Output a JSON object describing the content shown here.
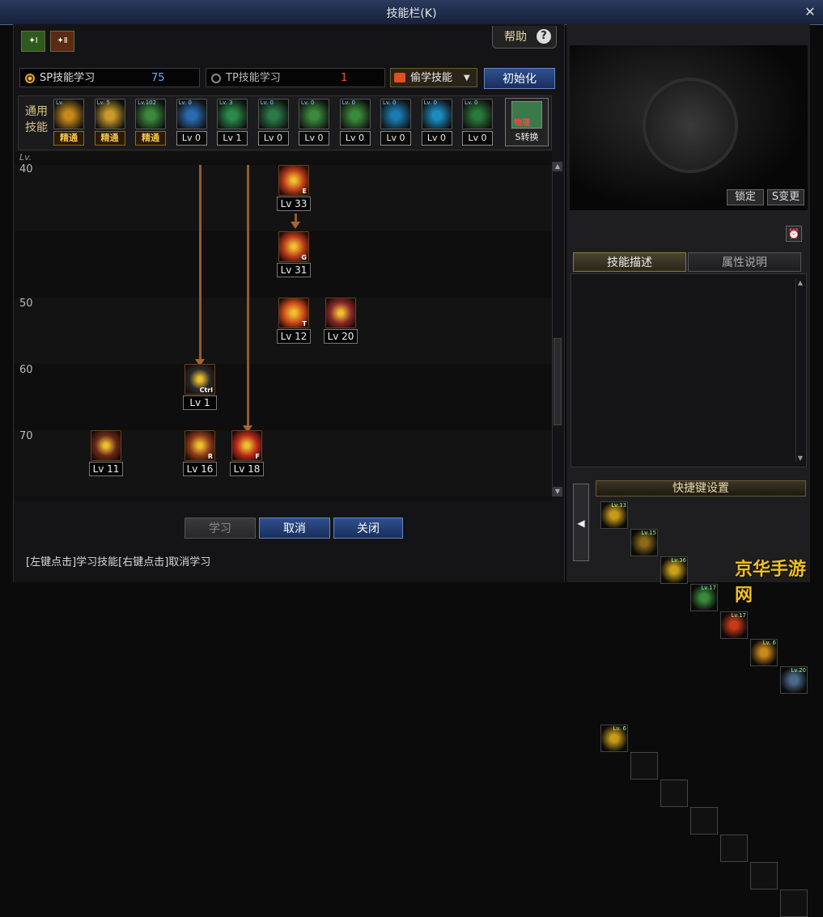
{
  "window": {
    "title": "技能栏(K)",
    "close_glyph": "✕"
  },
  "tabs": [
    {
      "label": "✦Ⅰ"
    },
    {
      "label": "✦Ⅱ"
    }
  ],
  "help": {
    "label": "帮助",
    "icon_glyph": "?"
  },
  "sp": {
    "label": "SP技能学习",
    "value": "75"
  },
  "tp": {
    "label": "TP技能学习",
    "value": "1"
  },
  "steal": {
    "label": "偷学技能"
  },
  "reset_button": "初始化",
  "general": {
    "label": "通用技能",
    "skills": [
      {
        "caption": "精通",
        "lv": "Lv.",
        "color": "#c8881a"
      },
      {
        "caption": "精通",
        "lv": "Lv. 5",
        "color": "#c89a2a"
      },
      {
        "caption": "精通",
        "lv": "Lv.102",
        "color": "#3a8a3a"
      },
      {
        "caption": "Lv 0",
        "lv": "Lv. 0",
        "color": "#2a6ab0"
      },
      {
        "caption": "Lv 1",
        "lv": "Lv. 3",
        "color": "#2a8a4a"
      },
      {
        "caption": "Lv 0",
        "lv": "Lv. 0",
        "color": "#2a7a4a"
      },
      {
        "caption": "Lv 0",
        "lv": "Lv. 0",
        "color": "#3a8a3a"
      },
      {
        "caption": "Lv 0",
        "lv": "Lv. 0",
        "color": "#3a8a3a"
      },
      {
        "caption": "Lv 0",
        "lv": "Lv. 0",
        "color": "#1a7ab0"
      },
      {
        "caption": "Lv 0",
        "lv": "Lv. 0",
        "color": "#1a8ac0"
      },
      {
        "caption": "Lv 0",
        "lv": "Lv. 0",
        "color": "#2a7a3a"
      }
    ],
    "convert": {
      "label": "S转换",
      "tag": "物理"
    }
  },
  "tree": {
    "header": "Lv.",
    "levels": [
      "40",
      "50",
      "60",
      "70"
    ],
    "skills": [
      {
        "caption": "Lv 33",
        "hotkey": "E",
        "color": "#b83a1a"
      },
      {
        "caption": "Lv 31",
        "hotkey": "G",
        "color": "#b83a1a"
      },
      {
        "caption": "Lv 12",
        "hotkey": "T",
        "color": "#c8481a"
      },
      {
        "caption": "Lv 20",
        "hotkey": "",
        "color": "#8a2a2a"
      },
      {
        "caption": "Lv 1",
        "hotkey": "Ctrl",
        "color": "#2a2a2a"
      },
      {
        "caption": "Lv 11",
        "hotkey": "",
        "color": "#6a2a1a"
      },
      {
        "caption": "Lv 16",
        "hotkey": "R",
        "color": "#8a3a1a"
      },
      {
        "caption": "Lv 18",
        "hotkey": "F",
        "color": "#b82a1a"
      }
    ]
  },
  "buttons": {
    "learn": "学习",
    "cancel": "取消",
    "close": "关闭"
  },
  "footer": "[左键点击]学习技能[右键点击]取消学习",
  "preview": {
    "lock": "锁定",
    "change": "S变更"
  },
  "right_tabs": {
    "desc": "技能描述",
    "attr": "属性说明"
  },
  "quickslot": {
    "title": "快捷键设置",
    "row1": [
      "Lv.33",
      "Lv.15",
      "Lv.36",
      "Lv.17",
      "Lv.17",
      "Lv. 6",
      "Lv.20"
    ],
    "row2": [
      "Lv. 6",
      "",
      "",
      "",
      "",
      "",
      ""
    ]
  },
  "watermark": "京华手游网"
}
